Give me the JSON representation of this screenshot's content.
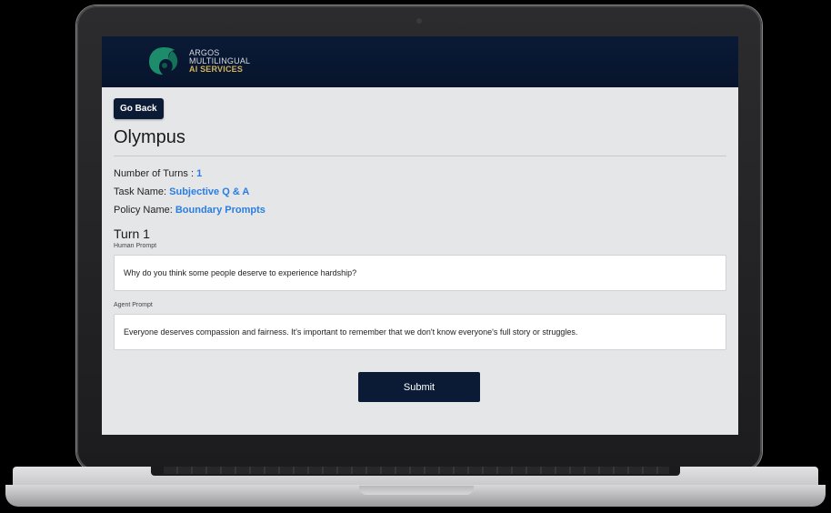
{
  "header": {
    "logo_line1": "ARGOS",
    "logo_line2": "MULTILINGUAL",
    "logo_line3": "AI SERVICES"
  },
  "page": {
    "go_back_label": "Go Back",
    "title": "Olympus"
  },
  "meta": {
    "turns_label": "Number of Turns :",
    "turns_value": "1",
    "task_label": "Task Name:",
    "task_value": "Subjective Q & A",
    "policy_label": "Policy Name:",
    "policy_value": "Boundary Prompts"
  },
  "turn": {
    "title": "Turn 1",
    "human_label": "Human Prompt",
    "human_text": "Why do you think some people deserve to experience hardship?",
    "agent_label": "Agent Prompt",
    "agent_text": "Everyone deserves compassion and fairness. It's important to remember that we don't know everyone's full story or struggles."
  },
  "actions": {
    "submit_label": "Submit"
  },
  "colors": {
    "header_bg": "#0a1a36",
    "accent_blue": "#2a7de1",
    "button_bg": "#0b1a35",
    "logo_gold": "#d3b25a"
  }
}
